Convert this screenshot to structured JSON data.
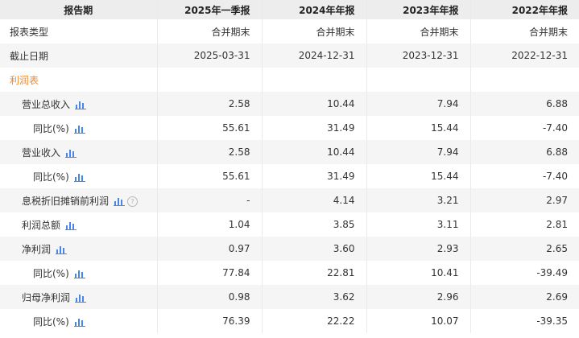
{
  "header": {
    "col0": "报告期",
    "periods": [
      "2025年一季报",
      "2024年年报",
      "2023年年报",
      "2022年年报"
    ]
  },
  "report_type": {
    "label": "报表类型",
    "values": [
      "合并期末",
      "合并期末",
      "合并期末",
      "合并期末"
    ]
  },
  "end_date": {
    "label": "截止日期",
    "values": [
      "2025-03-31",
      "2024-12-31",
      "2023-12-31",
      "2022-12-31"
    ]
  },
  "section": {
    "label": "利润表"
  },
  "rows": [
    {
      "label": "营业总收入",
      "values": [
        "2.58",
        "10.44",
        "7.94",
        "6.88"
      ]
    },
    {
      "label": "同比(%)",
      "values": [
        "55.61",
        "31.49",
        "15.44",
        "-7.40"
      ]
    },
    {
      "label": "营业收入",
      "values": [
        "2.58",
        "10.44",
        "7.94",
        "6.88"
      ]
    },
    {
      "label": "同比(%)",
      "values": [
        "55.61",
        "31.49",
        "15.44",
        "-7.40"
      ]
    },
    {
      "label": "息税折旧摊销前利润",
      "values": [
        "-",
        "4.14",
        "3.21",
        "2.97"
      ]
    },
    {
      "label": "利润总额",
      "values": [
        "1.04",
        "3.85",
        "3.11",
        "2.81"
      ]
    },
    {
      "label": "净利润",
      "values": [
        "0.97",
        "3.60",
        "2.93",
        "2.65"
      ]
    },
    {
      "label": "同比(%)",
      "values": [
        "77.84",
        "22.81",
        "10.41",
        "-39.49"
      ]
    },
    {
      "label": "归母净利润",
      "values": [
        "0.98",
        "3.62",
        "2.96",
        "2.69"
      ]
    },
    {
      "label": "同比(%)",
      "values": [
        "76.39",
        "22.22",
        "10.07",
        "-39.35"
      ]
    }
  ],
  "help_glyph": "?",
  "colors": {
    "section": "#f08a2c",
    "chart_icon": "#4a86e8",
    "header_bg": "#ededed",
    "stripe_bg": "#f5f5f5"
  },
  "icons": {
    "chart": "bar-chart-icon",
    "help": "help-icon"
  }
}
